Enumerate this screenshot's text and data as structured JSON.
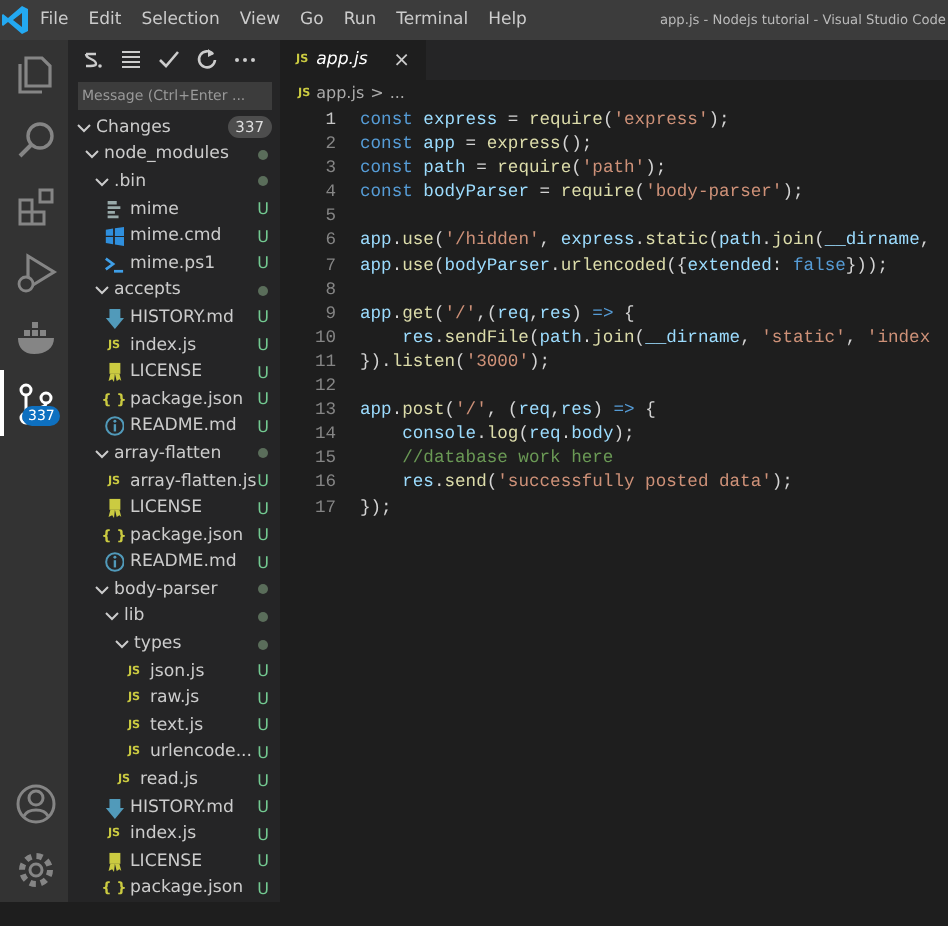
{
  "title_bar": {
    "menus": [
      "File",
      "Edit",
      "Selection",
      "View",
      "Go",
      "Run",
      "Terminal",
      "Help"
    ],
    "title": "app.js - Nodejs tutorial - Visual Studio Code"
  },
  "activity_bar": {
    "items": [
      {
        "selected": false
      },
      {
        "selected": false
      },
      {
        "selected": false
      },
      {
        "selected": false
      },
      {
        "selected": false
      },
      {
        "selected": true,
        "badge": "337"
      }
    ]
  },
  "source_control": {
    "message": {
      "placeholder": "Message (Ctrl+Enter ..."
    },
    "changes": {
      "label": "Changes",
      "count": "337",
      "expanded": true
    },
    "tree": [
      {
        "kind": "folder",
        "name": "node_modules",
        "expanded": true,
        "children": [
          {
            "kind": "folder",
            "name": ".bin",
            "expanded": true,
            "children": [
              {
                "kind": "plain",
                "name": "mime",
                "status": "U"
              },
              {
                "kind": "windows",
                "name": "mime.cmd",
                "status": "U"
              },
              {
                "kind": "terminal",
                "name": "mime.ps1",
                "status": "U"
              }
            ]
          },
          {
            "kind": "folder",
            "name": "accepts",
            "expanded": true,
            "children": [
              {
                "kind": "markdown",
                "name": "HISTORY.md",
                "status": "U"
              },
              {
                "kind": "js",
                "icon_text": "JS",
                "name": "index.js",
                "status": "U"
              },
              {
                "kind": "license",
                "name": "LICENSE",
                "status": "U"
              },
              {
                "kind": "json",
                "icon_text": "{ }",
                "name": "package.json",
                "status": "U"
              },
              {
                "kind": "info",
                "name": "README.md",
                "status": "U"
              }
            ]
          },
          {
            "kind": "folder",
            "name": "array-flatten",
            "expanded": true,
            "children": [
              {
                "kind": "js",
                "icon_text": "JS",
                "name": "array-flatten.js",
                "status": "U"
              },
              {
                "kind": "license",
                "name": "LICENSE",
                "status": "U"
              },
              {
                "kind": "json",
                "icon_text": "{ }",
                "name": "package.json",
                "status": "U"
              },
              {
                "kind": "info",
                "name": "README.md",
                "status": "U"
              }
            ]
          },
          {
            "kind": "folder",
            "name": "body-parser",
            "expanded": true,
            "children": [
              {
                "kind": "folder",
                "name": "lib",
                "expanded": true,
                "children": [
                  {
                    "kind": "folder",
                    "name": "types",
                    "expanded": true,
                    "children": [
                      {
                        "kind": "js",
                        "icon_text": "JS",
                        "name": "json.js",
                        "status": "U"
                      },
                      {
                        "kind": "js",
                        "icon_text": "JS",
                        "name": "raw.js",
                        "status": "U"
                      },
                      {
                        "kind": "js",
                        "icon_text": "JS",
                        "name": "text.js",
                        "status": "U"
                      },
                      {
                        "kind": "js",
                        "icon_text": "JS",
                        "name": "urlencode...",
                        "status": "U"
                      }
                    ]
                  },
                  {
                    "kind": "js",
                    "icon_text": "JS",
                    "name": "read.js",
                    "status": "U"
                  }
                ]
              },
              {
                "kind": "markdown",
                "name": "HISTORY.md",
                "status": "U"
              },
              {
                "kind": "js",
                "icon_text": "JS",
                "name": "index.js",
                "status": "U"
              },
              {
                "kind": "license",
                "name": "LICENSE",
                "status": "U"
              },
              {
                "kind": "json",
                "icon_text": "{ }",
                "name": "package.json",
                "status": "U"
              }
            ]
          }
        ]
      }
    ]
  },
  "editor": {
    "tabs": [
      {
        "icon_text": "JS",
        "label": "app.js",
        "preview": true,
        "close": "×"
      }
    ],
    "breadcrumb": {
      "icon_text": "JS",
      "file": "app.js",
      "separator": ">",
      "symbol": "..."
    },
    "lines": [
      {
        "number": "1",
        "current": true,
        "tokens": [
          {
            "kind": "keyword",
            "text": "const"
          },
          {
            "kind": "variable",
            "text": " express"
          },
          {
            "kind": "plain",
            "text": " = "
          },
          {
            "kind": "function",
            "text": "require"
          },
          {
            "kind": "plain",
            "text": "("
          },
          {
            "kind": "string",
            "text": "'express'"
          },
          {
            "kind": "plain",
            "text": ");"
          }
        ]
      },
      {
        "number": "2",
        "current": false,
        "tokens": [
          {
            "kind": "keyword",
            "text": "const"
          },
          {
            "kind": "variable",
            "text": " app"
          },
          {
            "kind": "plain",
            "text": " = "
          },
          {
            "kind": "function",
            "text": "express"
          },
          {
            "kind": "plain",
            "text": "();"
          }
        ]
      },
      {
        "number": "3",
        "current": false,
        "tokens": [
          {
            "kind": "keyword",
            "text": "const"
          },
          {
            "kind": "variable",
            "text": " path"
          },
          {
            "kind": "plain",
            "text": " = "
          },
          {
            "kind": "function",
            "text": "require"
          },
          {
            "kind": "plain",
            "text": "("
          },
          {
            "kind": "string",
            "text": "'path'"
          },
          {
            "kind": "plain",
            "text": ");"
          }
        ]
      },
      {
        "number": "4",
        "current": false,
        "tokens": [
          {
            "kind": "keyword",
            "text": "const"
          },
          {
            "kind": "variable",
            "text": " bodyParser"
          },
          {
            "kind": "plain",
            "text": " = "
          },
          {
            "kind": "function",
            "text": "require"
          },
          {
            "kind": "plain",
            "text": "("
          },
          {
            "kind": "string",
            "text": "'body-parser'"
          },
          {
            "kind": "plain",
            "text": ");"
          }
        ]
      },
      {
        "number": "5",
        "current": false
      },
      {
        "number": "6",
        "current": false,
        "tokens": [
          {
            "kind": "variable",
            "text": "app"
          },
          {
            "kind": "plain",
            "text": "."
          },
          {
            "kind": "function",
            "text": "use"
          },
          {
            "kind": "plain",
            "text": "("
          },
          {
            "kind": "string",
            "text": "'/hidden'"
          },
          {
            "kind": "plain",
            "text": ","
          },
          {
            "kind": "variable",
            "text": " express"
          },
          {
            "kind": "plain",
            "text": "."
          },
          {
            "kind": "function",
            "text": "static"
          },
          {
            "kind": "plain",
            "text": "("
          },
          {
            "kind": "variable",
            "text": "path"
          },
          {
            "kind": "plain",
            "text": "."
          },
          {
            "kind": "function",
            "text": "join"
          },
          {
            "kind": "plain",
            "text": "("
          },
          {
            "kind": "variable",
            "text": "__dirname"
          },
          {
            "kind": "plain",
            "text": ","
          }
        ]
      },
      {
        "number": "7",
        "current": false,
        "tokens": [
          {
            "kind": "variable",
            "text": "app"
          },
          {
            "kind": "plain",
            "text": "."
          },
          {
            "kind": "function",
            "text": "use"
          },
          {
            "kind": "plain",
            "text": "("
          },
          {
            "kind": "variable",
            "text": "bodyParser"
          },
          {
            "kind": "plain",
            "text": "."
          },
          {
            "kind": "function",
            "text": "urlencoded"
          },
          {
            "kind": "plain",
            "text": "({"
          },
          {
            "kind": "variable",
            "text": "extended"
          },
          {
            "kind": "plain",
            "text": ":"
          },
          {
            "kind": "keyword",
            "text": " false"
          },
          {
            "kind": "plain",
            "text": "}));"
          }
        ]
      },
      {
        "number": "8",
        "current": false
      },
      {
        "number": "9",
        "current": false,
        "tokens": [
          {
            "kind": "variable",
            "text": "app"
          },
          {
            "kind": "plain",
            "text": "."
          },
          {
            "kind": "function",
            "text": "get"
          },
          {
            "kind": "plain",
            "text": "("
          },
          {
            "kind": "string",
            "text": "'/'"
          },
          {
            "kind": "plain",
            "text": ",("
          },
          {
            "kind": "variable",
            "text": "req"
          },
          {
            "kind": "plain",
            "text": ","
          },
          {
            "kind": "variable",
            "text": "res"
          },
          {
            "kind": "plain",
            "text": ")"
          },
          {
            "kind": "keyword",
            "text": " =>"
          },
          {
            "kind": "plain",
            "text": " {"
          }
        ]
      },
      {
        "number": "10",
        "current": false,
        "tokens": [
          {
            "kind": "variable",
            "text": "    res"
          },
          {
            "kind": "plain",
            "text": "."
          },
          {
            "kind": "function",
            "text": "sendFile"
          },
          {
            "kind": "plain",
            "text": "("
          },
          {
            "kind": "variable",
            "text": "path"
          },
          {
            "kind": "plain",
            "text": "."
          },
          {
            "kind": "function",
            "text": "join"
          },
          {
            "kind": "plain",
            "text": "("
          },
          {
            "kind": "variable",
            "text": "__dirname"
          },
          {
            "kind": "plain",
            "text": ","
          },
          {
            "kind": "string",
            "text": " 'static'"
          },
          {
            "kind": "plain",
            "text": ","
          },
          {
            "kind": "string",
            "text": " 'index"
          }
        ]
      },
      {
        "number": "11",
        "current": false,
        "tokens": [
          {
            "kind": "plain",
            "text": "})."
          },
          {
            "kind": "function",
            "text": "listen"
          },
          {
            "kind": "plain",
            "text": "("
          },
          {
            "kind": "string",
            "text": "'3000'"
          },
          {
            "kind": "plain",
            "text": ");"
          }
        ]
      },
      {
        "number": "12",
        "current": false
      },
      {
        "number": "13",
        "current": false,
        "tokens": [
          {
            "kind": "variable",
            "text": "app"
          },
          {
            "kind": "plain",
            "text": "."
          },
          {
            "kind": "function",
            "text": "post"
          },
          {
            "kind": "plain",
            "text": "("
          },
          {
            "kind": "string",
            "text": "'/'"
          },
          {
            "kind": "plain",
            "text": ", ("
          },
          {
            "kind": "variable",
            "text": "req"
          },
          {
            "kind": "plain",
            "text": ","
          },
          {
            "kind": "variable",
            "text": "res"
          },
          {
            "kind": "plain",
            "text": ")"
          },
          {
            "kind": "keyword",
            "text": " =>"
          },
          {
            "kind": "plain",
            "text": " {"
          }
        ]
      },
      {
        "number": "14",
        "current": false,
        "tokens": [
          {
            "kind": "variable",
            "text": "    console"
          },
          {
            "kind": "plain",
            "text": "."
          },
          {
            "kind": "function",
            "text": "log"
          },
          {
            "kind": "plain",
            "text": "("
          },
          {
            "kind": "variable",
            "text": "req"
          },
          {
            "kind": "plain",
            "text": "."
          },
          {
            "kind": "variable",
            "text": "body"
          },
          {
            "kind": "plain",
            "text": ");"
          }
        ]
      },
      {
        "number": "15",
        "current": false,
        "tokens": [
          {
            "kind": "comment",
            "text": "    //database work here"
          }
        ]
      },
      {
        "number": "16",
        "current": false,
        "tokens": [
          {
            "kind": "variable",
            "text": "    res"
          },
          {
            "kind": "plain",
            "text": "."
          },
          {
            "kind": "function",
            "text": "send"
          },
          {
            "kind": "plain",
            "text": "("
          },
          {
            "kind": "string",
            "text": "'successfully posted data'"
          },
          {
            "kind": "plain",
            "text": ");"
          }
        ]
      },
      {
        "number": "17",
        "current": false,
        "tokens": [
          {
            "kind": "plain",
            "text": "});"
          }
        ]
      }
    ]
  }
}
